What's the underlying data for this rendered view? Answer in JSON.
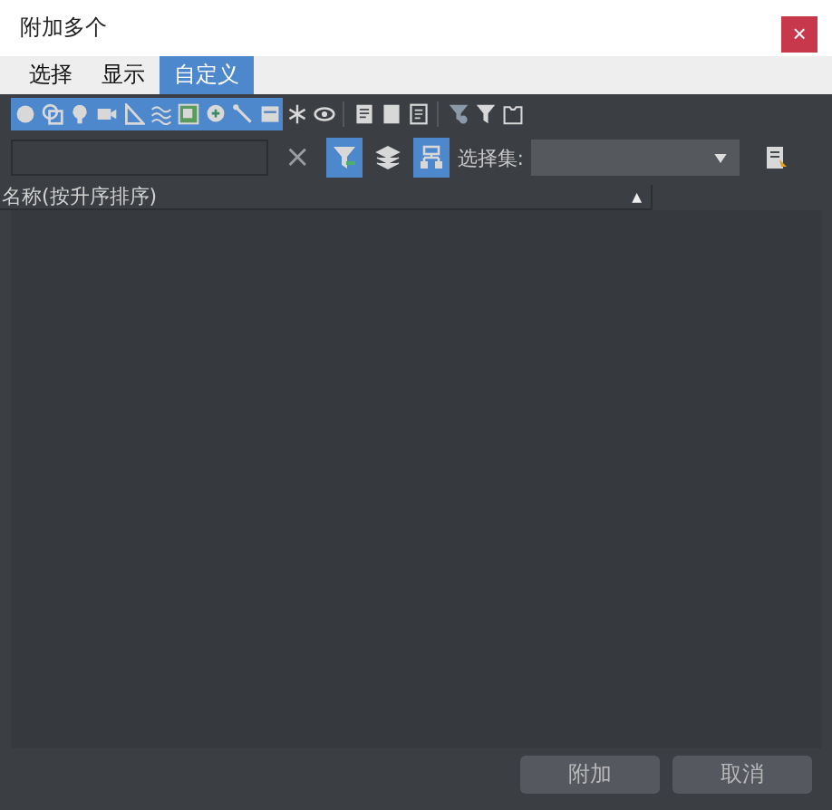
{
  "window": {
    "title": "附加多个",
    "close": "×"
  },
  "menu": [
    {
      "label": "选择",
      "selected": false
    },
    {
      "label": "显示",
      "selected": false
    },
    {
      "label": "自定义",
      "selected": true
    }
  ],
  "type_filters": [
    {
      "on": true
    },
    {
      "on": true
    },
    {
      "on": true
    },
    {
      "on": true
    },
    {
      "on": true
    },
    {
      "on": true
    },
    {
      "on": true
    },
    {
      "on": true
    },
    {
      "on": true
    },
    {
      "on": true
    },
    {
      "on": false
    },
    {
      "on": false
    }
  ],
  "view_tools": [
    {
      "on": false
    },
    {
      "on": false
    },
    {
      "on": false
    },
    {
      "on": false
    },
    {
      "on": false
    },
    {
      "on": false
    }
  ],
  "search": {
    "clear": "×",
    "filter_on": true,
    "hierarchy_on": true
  },
  "selection_set": {
    "label": "选择集:"
  },
  "list": {
    "column": "名称(按升序排序)",
    "sort": "▲"
  },
  "buttons": [
    "附加",
    "取消"
  ]
}
